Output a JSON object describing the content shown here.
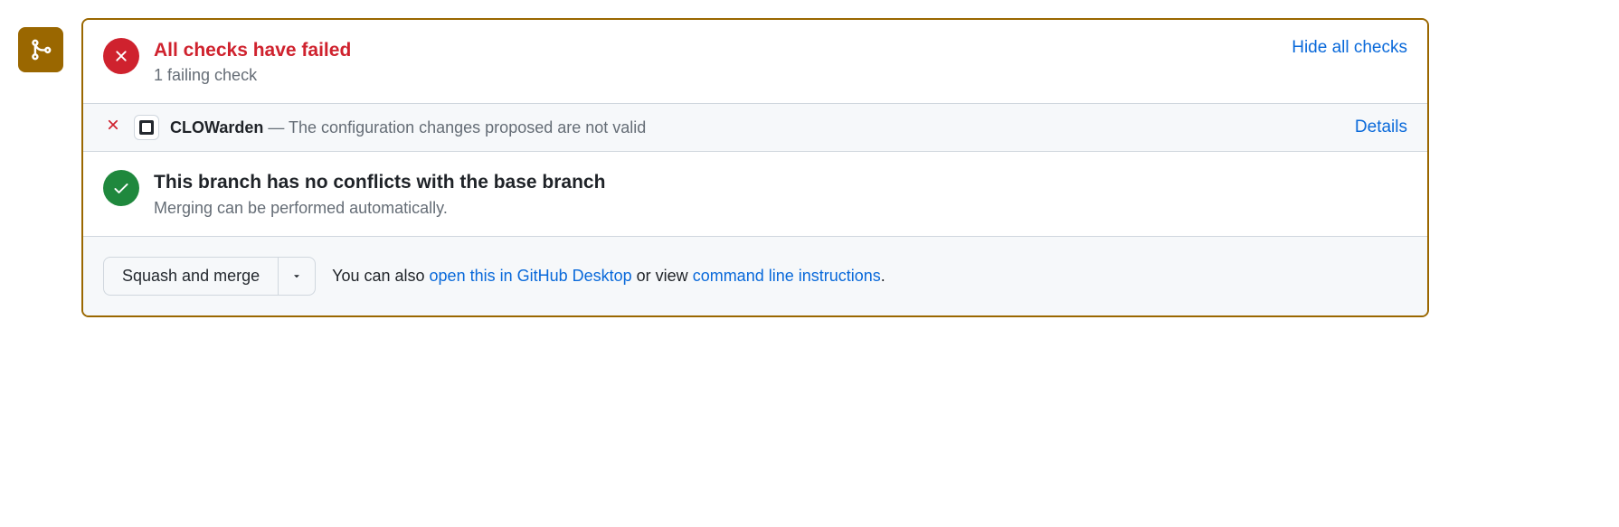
{
  "checks": {
    "title": "All checks have failed",
    "subtitle": "1 failing check",
    "toggle_link": "Hide all checks",
    "items": [
      {
        "name": "CLOWarden",
        "separator": " — ",
        "description": "The configuration changes proposed are not valid",
        "details_link": "Details"
      }
    ]
  },
  "conflicts": {
    "title": "This branch has no conflicts with the base branch",
    "subtitle": "Merging can be performed automatically."
  },
  "merge": {
    "button_label": "Squash and merge",
    "hint_prefix": "You can also ",
    "desktop_link": "open this in GitHub Desktop",
    "hint_middle": " or view ",
    "cli_link": "command line instructions",
    "hint_suffix": "."
  }
}
